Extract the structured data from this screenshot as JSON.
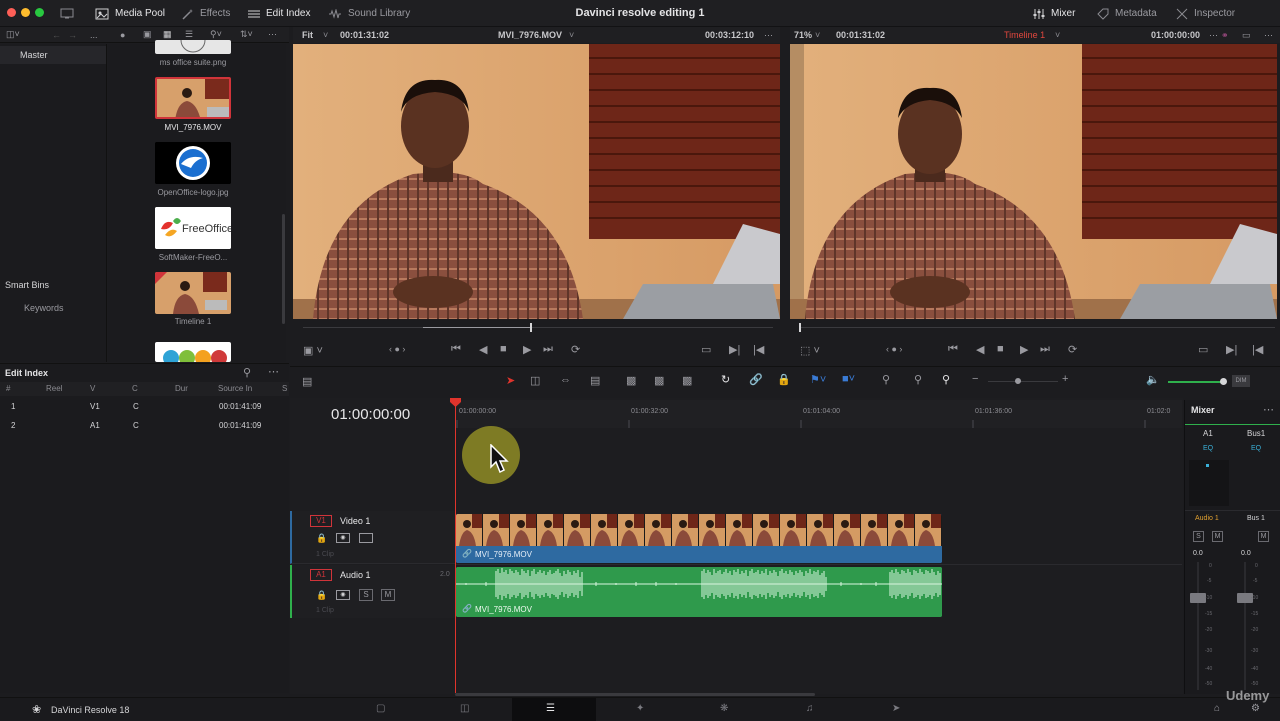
{
  "topbar": {
    "media_pool": "Media Pool",
    "effects": "Effects",
    "edit_index": "Edit Index",
    "sound_library": "Sound Library",
    "project_title": "Davinci resolve editing 1",
    "mixer": "Mixer",
    "metadata": "Metadata",
    "inspector": "Inspector"
  },
  "viewer_source": {
    "zoom": "Fit",
    "timecode": "00:01:31:02",
    "clip_name": "MVI_7976.MOV",
    "duration": "00:03:12:10"
  },
  "viewer_timeline": {
    "zoom": "71%",
    "timecode": "00:01:31:02",
    "timeline_name": "Timeline 1",
    "record_timecode": "01:00:00:00"
  },
  "bins": {
    "master": "Master",
    "smart_bins": "Smart Bins",
    "keywords": "Keywords"
  },
  "media": [
    {
      "label": "ms office suite.png"
    },
    {
      "label": "MVI_7976.MOV"
    },
    {
      "label": "OpenOffice-logo.jpg"
    },
    {
      "label": "SoftMaker-FreeO..."
    },
    {
      "label": "Timeline 1"
    }
  ],
  "freeoffice_text": "FreeOffice",
  "edit_index": {
    "title": "Edit Index",
    "headers": [
      "#",
      "Reel",
      "V",
      "C",
      "Dur",
      "Source In",
      "S"
    ],
    "rows": [
      {
        "num": "1",
        "v": "V1",
        "c": "C",
        "source_in": "00:01:41:09"
      },
      {
        "num": "2",
        "v": "A1",
        "c": "C",
        "source_in": "00:01:41:09"
      }
    ]
  },
  "timeline": {
    "timecode": "01:00:00:00",
    "ruler": [
      "01:00:00:00",
      "01:00:32:00",
      "01:01:04:00",
      "01:01:36:00",
      "01:02:0"
    ],
    "video_track": {
      "id": "V1",
      "name": "Video 1",
      "clip_count": "1 Clip",
      "clip_name": "MVI_7976.MOV"
    },
    "audio_track": {
      "id": "A1",
      "name": "Audio 1",
      "channels": "2.0",
      "clip_count": "1 Clip",
      "clip_name": "MVI_7976.MOV",
      "solo": "S",
      "mute": "M"
    }
  },
  "mixer": {
    "title": "Mixer",
    "ch1": "A1",
    "ch2": "Bus1",
    "eq": "EQ",
    "ch1_label": "Audio 1",
    "ch2_label": "Bus 1",
    "solo": "S",
    "mute": "M",
    "level1": "0.0",
    "level2": "0.0",
    "scale": [
      "0",
      "-5",
      "-10",
      "-15",
      "-20",
      "-30",
      "-40",
      "-50"
    ]
  },
  "bottombar": {
    "app_name": "DaVinci Resolve 18",
    "watermark": "Udemy"
  },
  "colors": {
    "video_clip": "#2e6aa1",
    "audio_clip": "#2f9a4c",
    "playhead": "#e0342c",
    "timeline_name": "#e0473e"
  }
}
